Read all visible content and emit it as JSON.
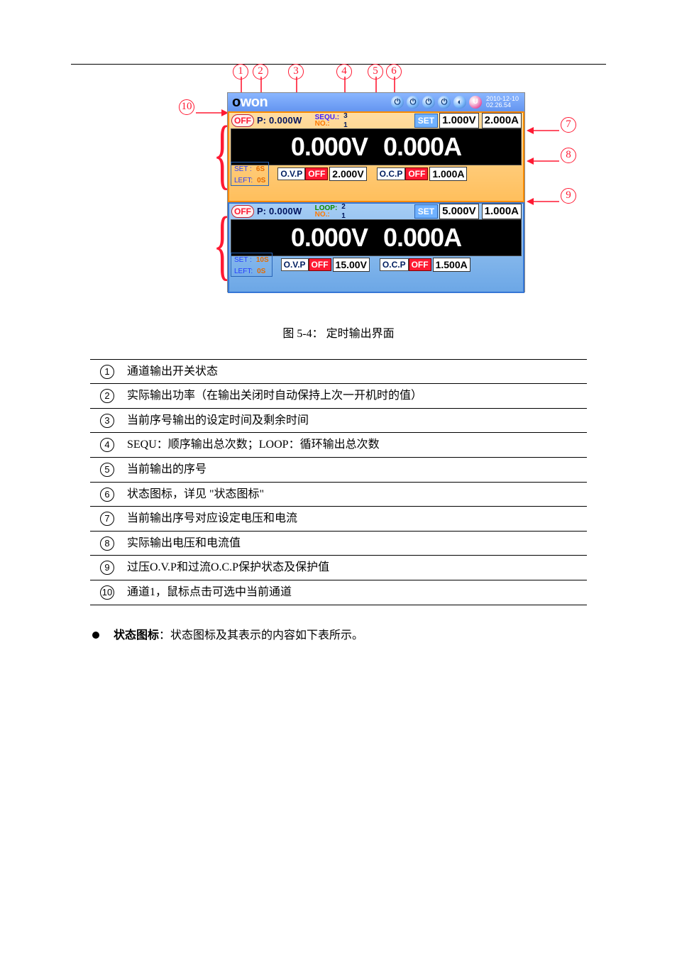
{
  "caption_prefix": "图 5-4：",
  "caption": "定时输出界面",
  "device": {
    "logo_text": "owon",
    "date": "2010-12-10",
    "time": "02.26.54",
    "channels": [
      {
        "off": "OFF",
        "power_label": "P:",
        "power": "0.000W",
        "mode_label1": "SEQU.:",
        "mode_val1": "3",
        "mode_label2": "NO.:",
        "mode_val2": "1",
        "set": "SET",
        "set_v": "1.000V",
        "set_a": "2.000A",
        "read_v": "0.000V",
        "read_a": "0.000A",
        "t_set_label": "SET :",
        "t_set_val": "6S",
        "t_left_label": "LEFT:",
        "t_left_val": "0S",
        "ovp_label": "O.V.P",
        "ovp_state": "OFF",
        "ovp_v": "2.000V",
        "ocp_label": "O.C.P",
        "ocp_state": "OFF",
        "ocp_a": "1.000A"
      },
      {
        "off": "OFF",
        "power_label": "P:",
        "power": "0.000W",
        "mode_label1": "LOOP:",
        "mode_val1": "2",
        "mode_label2": "NO.:",
        "mode_val2": "1",
        "set": "SET",
        "set_v": "5.000V",
        "set_a": "1.000A",
        "read_v": "0.000V",
        "read_a": "0.000A",
        "t_set_label": "SET :",
        "t_set_val": "10S",
        "t_left_label": "LEFT:",
        "t_left_val": "0S",
        "ovp_label": "O.V.P",
        "ovp_state": "OFF",
        "ovp_v": "15.00V",
        "ocp_label": "O.C.P",
        "ocp_state": "OFF",
        "ocp_a": "1.500A"
      }
    ]
  },
  "legend": [
    {
      "n": "1",
      "text": "通道输出开关状态"
    },
    {
      "n": "2",
      "text": "实际输出功率（在输出关闭时自动保持上次一开机时的值）"
    },
    {
      "n": "3",
      "text": "当前序号输出的设定时间及剩余时间"
    },
    {
      "n": "4",
      "text": "SEQU：顺序输出总次数；LOOP：循环输出总次数"
    },
    {
      "n": "5",
      "text": "当前输出的序号"
    },
    {
      "n": "6",
      "text": "状态图标，详见 \"状态图标\""
    },
    {
      "n": "7",
      "text": "当前输出序号对应设定电压和电流"
    },
    {
      "n": "8",
      "text": "实际输出电压和电流值"
    },
    {
      "n": "9",
      "text": "过压O.V.P和过流O.C.P保护状态及保护值"
    },
    {
      "n": "10",
      "text": "通道1，鼠标点击可选中当前通道"
    }
  ],
  "bullet": {
    "title": "状态图标",
    "text": "：状态图标及其表示的内容如下表所示。"
  },
  "callout_nums": {
    "c1": "1",
    "c2": "2",
    "c3": "3",
    "c4": "4",
    "c5": "5",
    "c6": "6",
    "c7": "7",
    "c8": "8",
    "c9": "9",
    "c10": "10"
  }
}
